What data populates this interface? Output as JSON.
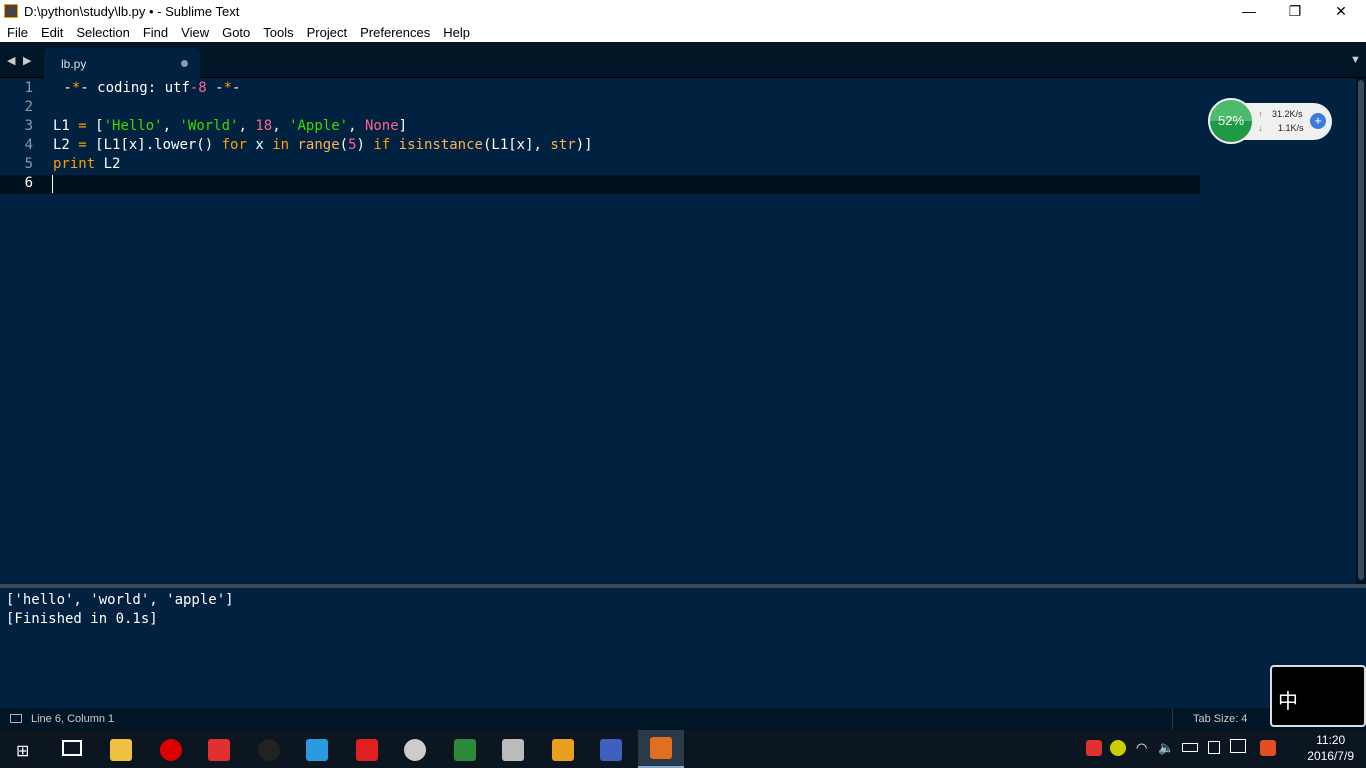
{
  "window": {
    "title": "D:\\python\\study\\lb.py • - Sublime Text",
    "minimize": "—",
    "maximize": "❐",
    "close": "✕"
  },
  "menu": [
    "File",
    "Edit",
    "Selection",
    "Find",
    "View",
    "Goto",
    "Tools",
    "Project",
    "Preferences",
    "Help"
  ],
  "tab": {
    "label": "lb.py"
  },
  "code": {
    "line_numbers": [
      "1",
      "2",
      "3",
      "4",
      "5",
      "6"
    ],
    "l1": [
      " -",
      "*",
      "- coding: utf",
      "-8",
      " -",
      "*",
      "-"
    ],
    "l3": [
      "L1 ",
      "=",
      " [",
      "'Hello'",
      ", ",
      "'World'",
      ", ",
      "18",
      ", ",
      "'Apple'",
      ", ",
      "None",
      "]"
    ],
    "l4": [
      "L2 ",
      "=",
      " [L1[x].lower() ",
      "for",
      " x ",
      "in",
      " ",
      "range",
      "(",
      "5",
      ") ",
      "if",
      " ",
      "isinstance",
      "(L1[x], ",
      "str",
      ")]"
    ],
    "l5": [
      "print",
      " L2"
    ]
  },
  "widget": {
    "percent": "52%",
    "upload": "31.2K/s",
    "download": "1.1K/s"
  },
  "output": {
    "lines": [
      "['hello', 'world', 'apple']",
      "[Finished in 0.1s]"
    ]
  },
  "status": {
    "position": "Line 6, Column 1",
    "tab_size": "Tab Size: 4"
  },
  "ime": {
    "label": "中"
  },
  "clock": {
    "time": "11:20",
    "date": "2016/7/9"
  },
  "colors": {
    "background": "#002240",
    "string": "#3ad900",
    "number": "#ff628c",
    "keyword": "#ff9d00"
  }
}
